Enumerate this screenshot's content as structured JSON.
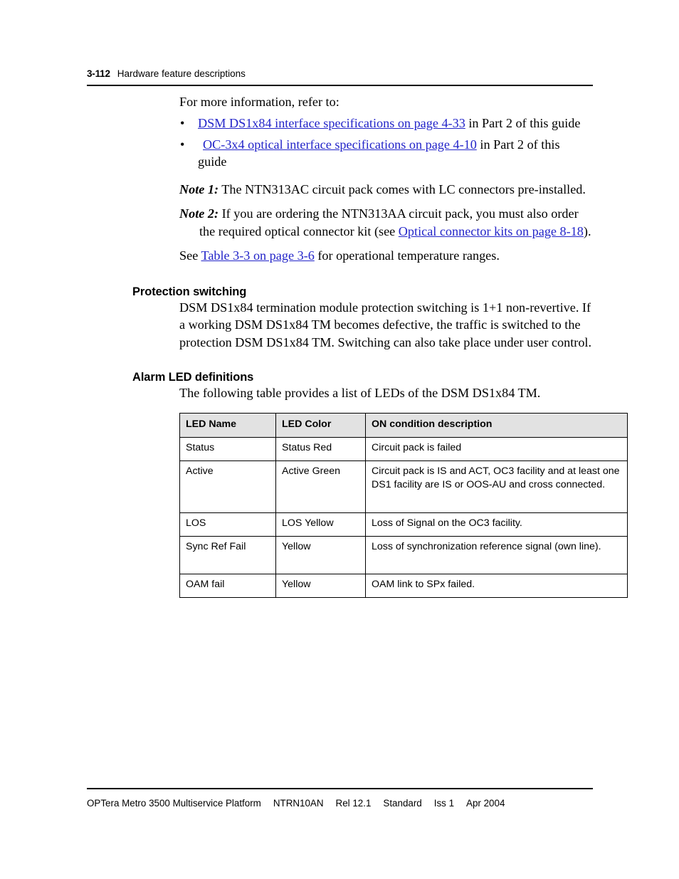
{
  "header": {
    "folio": "3-112",
    "chapter_title": "Hardware feature descriptions"
  },
  "intro": {
    "lead": "For more information, refer to:",
    "bullets": [
      {
        "bullet": "•",
        "link": "DSM DS1x84 interface specifications on page 4-33",
        "trailing": " in Part 2 of this guide",
        "continuation": ""
      },
      {
        "bullet": "•",
        "link": "OC-3x4 optical interface specifications on page 4-10",
        "trailing": " in Part 2 of this",
        "continuation": "guide"
      }
    ],
    "note1": {
      "label": "Note 1:",
      "text": "The NTN313AC circuit pack comes with LC connectors pre-installed."
    },
    "note2": {
      "label": "Note 2:",
      "text_before": "If you are ordering the NTN313AA circuit pack, you must also order the required optical connector kit (see ",
      "link": "Optical connector kits on page 8-18",
      "text_after": ")."
    },
    "see_line": {
      "before": "See ",
      "link": "Table 3-3 on page 3-6",
      "after": " for operational temperature ranges."
    }
  },
  "protection_switching": {
    "heading": "Protection switching",
    "body": "DSM DS1x84 termination module protection switching is 1+1 non-revertive. If a working DSM DS1x84 TM becomes defective, the traffic is switched to the protection DSM DS1x84 TM. Switching can also take place under user control."
  },
  "alarm_led": {
    "heading": "Alarm LED definitions",
    "body": "The following table provides a list of LEDs of the DSM DS1x84 TM.",
    "table": {
      "columns": [
        "LED Name",
        "LED Color",
        "ON condition description"
      ],
      "rows": [
        {
          "name": "Status",
          "color": "Status Red",
          "description": "Circuit pack is failed"
        },
        {
          "name": "Active",
          "color": "Active Green",
          "description": "Circuit pack is IS and ACT, OC3 facility and at least one DS1 facility are IS or OOS-AU and cross connected."
        },
        {
          "name": "LOS",
          "color": "LOS Yellow",
          "description": "Loss of Signal on the OC3 facility."
        },
        {
          "name": "Sync Ref Fail",
          "color": "Yellow",
          "description": "Loss of synchronization reference signal (own line)."
        },
        {
          "name": "OAM fail",
          "color": "Yellow",
          "description": "OAM link to SPx failed."
        }
      ]
    }
  },
  "footer": {
    "product": "OPTera Metro 3500 Multiservice Platform",
    "doc_number": "NTRN10AN",
    "release": "Rel 12.1",
    "status": "Standard",
    "issue": "Iss 1",
    "date": "Apr 2004"
  },
  "colors": {
    "link": "#2325c9",
    "table_header_bg": "#e2e2e2",
    "rule": "#000000",
    "text": "#000000"
  }
}
